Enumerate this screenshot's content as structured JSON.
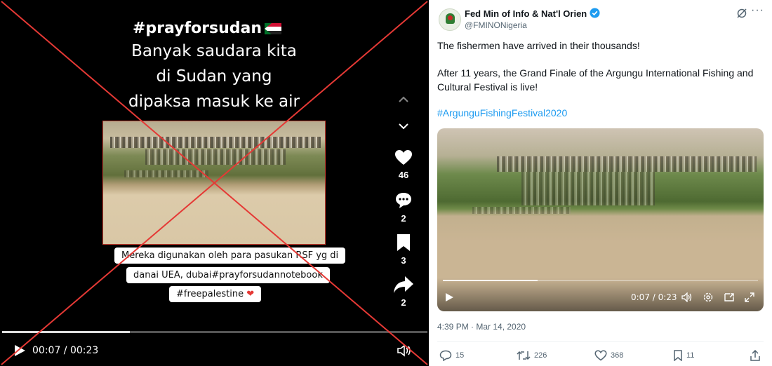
{
  "left_panel": {
    "hashtag_title": "#prayforsudan",
    "caption_lines": [
      "Banyak saudara kita",
      "di Sudan yang",
      "dipaksa masuk ke air"
    ],
    "bubble_lines": [
      "Mereka digunakan oleh para pasukan RSF yg di",
      "danai UEA, dubai#prayforsudannotebook",
      "#freepalestine"
    ],
    "likes": "46",
    "comments": "2",
    "bookmarks": "3",
    "shares": "2",
    "time": "00:07 / 00:23",
    "progress": 0.3
  },
  "tweet": {
    "display_name": "Fed Min of Info & Nat'l Orien",
    "handle": "@FMINONigeria",
    "text_line1": "The fishermen have arrived in their thousands!",
    "text_line2a": "After 11 years, the Grand Finale of the Argungu International Fishing and",
    "text_line2b": "Cultural Festival is live!",
    "hashtag": "#ArgunguFishingFestival2020",
    "video_time": "0:07 / 0:23",
    "video_progress": 0.3,
    "timestamp": "4:39 PM · Mar 14, 2020",
    "replies": "15",
    "reposts": "226",
    "likes": "368",
    "bookmarks": "11"
  },
  "colors": {
    "cross": "#e53935",
    "link": "#1d9bf0",
    "verified": "#1d9bf0"
  },
  "icons": {
    "left_sidebar": [
      "chevron-up-icon",
      "chevron-down-icon",
      "heart-icon",
      "comment-icon",
      "bookmark-icon",
      "share-icon"
    ],
    "left_player": [
      "play-icon",
      "volume-icon"
    ],
    "tweet_header": [
      "verified-icon",
      "grok-icon",
      "more-icon"
    ],
    "tweet_video": [
      "play-icon",
      "volume-icon",
      "settings-icon",
      "pip-icon",
      "fullscreen-icon"
    ],
    "tweet_actions": [
      "reply-icon",
      "repost-icon",
      "like-icon",
      "bookmark-icon",
      "share-icon"
    ]
  }
}
